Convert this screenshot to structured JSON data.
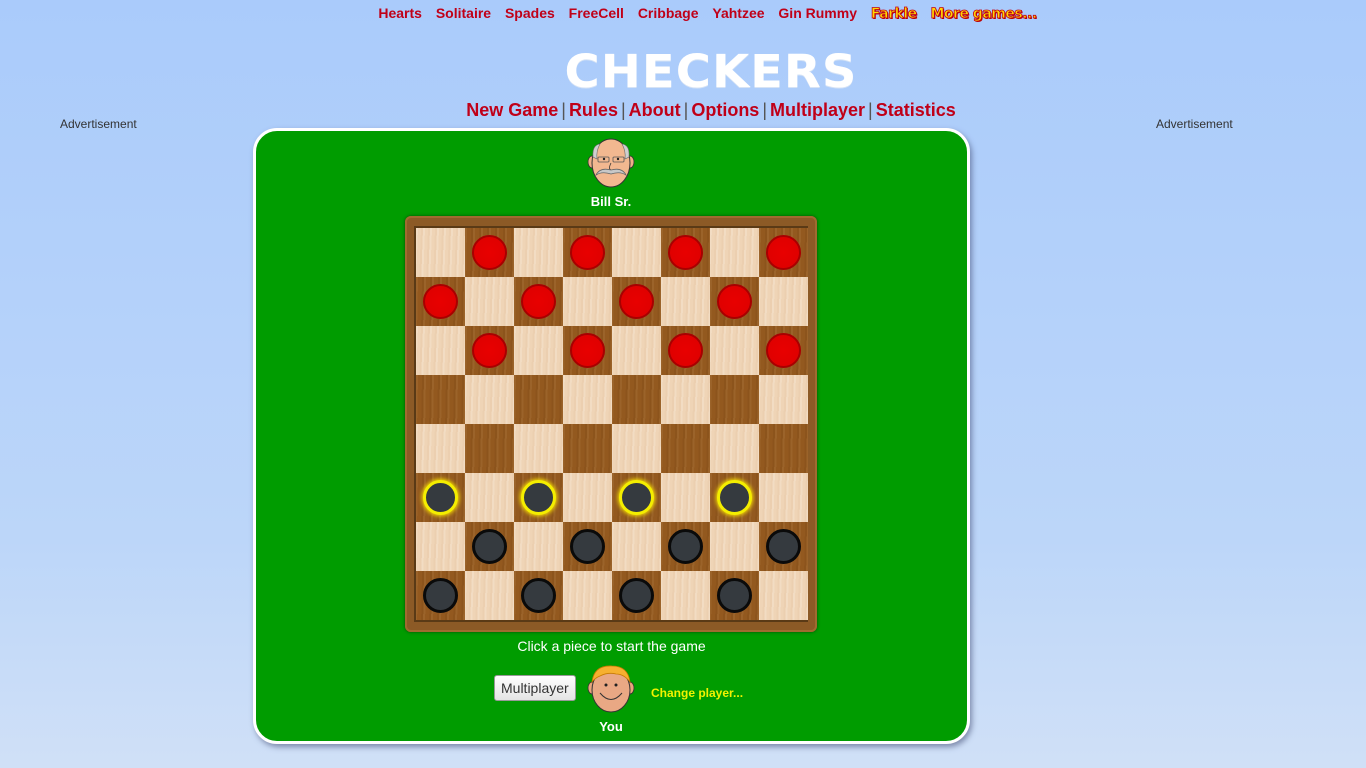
{
  "top_nav": {
    "links": [
      "Hearts",
      "Solitaire",
      "Spades",
      "FreeCell",
      "Cribbage",
      "Yahtzee",
      "Gin Rummy"
    ],
    "special_links": [
      "Farkle",
      "More games..."
    ]
  },
  "logo": {
    "text": "CHECKERS"
  },
  "main_nav": {
    "items": [
      "New Game",
      "Rules",
      "About",
      "Options",
      "Multiplayer",
      "Statistics"
    ],
    "separator": "|"
  },
  "ads": {
    "left_label": "Advertisement",
    "right_label": "Advertisement"
  },
  "opponent": {
    "name": "Bill Sr.",
    "avatar": "old-man-avatar"
  },
  "player": {
    "name": "You",
    "avatar": "boy-avatar"
  },
  "board": {
    "size": 8,
    "colors": {
      "light": "#efd4b6",
      "dark": "#93591f",
      "red_piece": "#e00000",
      "black_piece": "#353a3f",
      "highlight": "#f4ee00"
    },
    "pieces": [
      [
        "",
        "r",
        "",
        "r",
        "",
        "r",
        "",
        "r"
      ],
      [
        "r",
        "",
        "r",
        "",
        "r",
        "",
        "r",
        ""
      ],
      [
        "",
        "r",
        "",
        "r",
        "",
        "r",
        "",
        "r"
      ],
      [
        "",
        "",
        "",
        "",
        "",
        "",
        "",
        ""
      ],
      [
        "",
        "",
        "",
        "",
        "",
        "",
        "",
        ""
      ],
      [
        "b*",
        "",
        "b*",
        "",
        "b*",
        "",
        "b*",
        ""
      ],
      [
        "",
        "b",
        "",
        "b",
        "",
        "b",
        "",
        "b"
      ],
      [
        "b",
        "",
        "b",
        "",
        "b",
        "",
        "b",
        ""
      ]
    ],
    "legend": {
      "r": "red piece (opponent)",
      "b": "black piece (you)",
      "b*": "black piece, movable (highlighted)"
    }
  },
  "status": {
    "message": "Click a piece to start the game"
  },
  "controls": {
    "multiplayer_button": "Multiplayer",
    "change_player_link": "Change player..."
  }
}
